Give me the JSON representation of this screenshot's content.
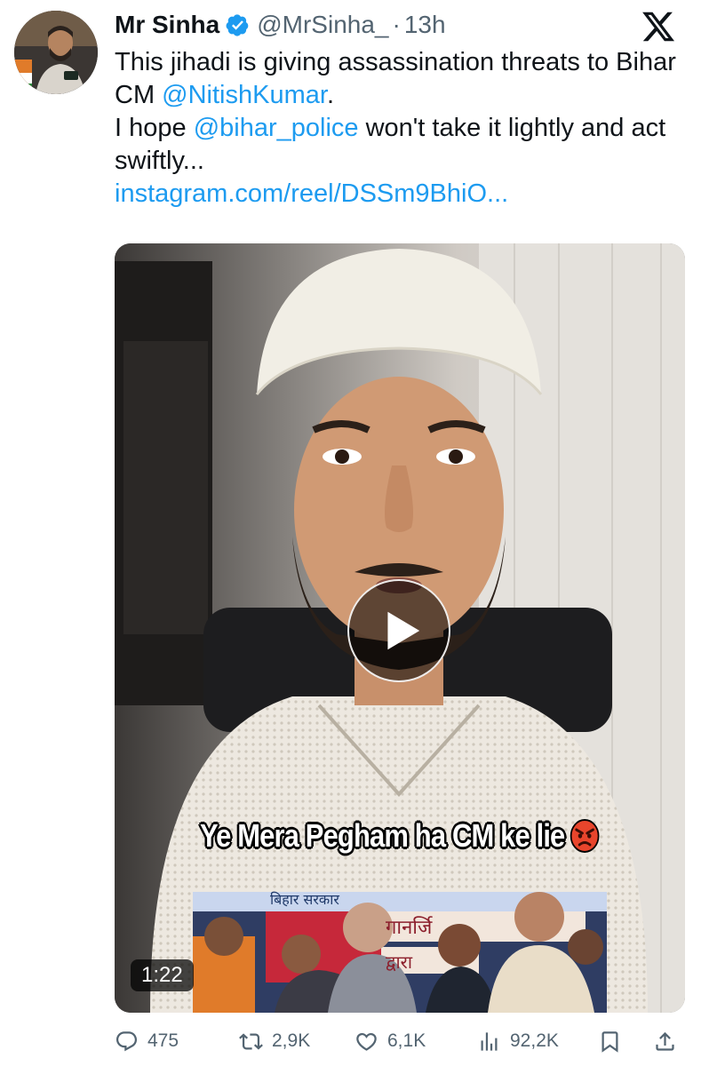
{
  "user": {
    "display_name": "Mr Sinha",
    "handle": "@MrSinha_",
    "separator": "·",
    "time": "13h"
  },
  "tweet": {
    "line1_pre": "This jihadi is giving assassination threats to Bihar CM ",
    "mention1": "@NitishKumar",
    "line1_post": ".",
    "line2_pre": "I hope ",
    "mention2": "@bihar_police",
    "line2_post": " won't take it lightly and act swiftly...",
    "link": "instagram.com/reel/DSSm9BhiO..."
  },
  "media": {
    "caption": "Ye Mera Pegham ha CM ke lie",
    "duration": "1:22",
    "inset_banner_text": "गानर्जि",
    "inset_banner_text2": "द्वारा",
    "inset_top_text": "बिहार सरकार"
  },
  "actions": {
    "replies": "475",
    "reposts": "2,9K",
    "likes": "6,1K",
    "views": "92,2K"
  },
  "colors": {
    "link": "#1d9bf0",
    "secondary_text": "#536471",
    "verified": "#1d9bf0"
  },
  "icons": [
    "verified-badge-icon",
    "x-logo-icon",
    "play-icon",
    "reply-icon",
    "repost-icon",
    "like-icon",
    "views-icon",
    "bookmark-icon",
    "share-icon",
    "angry-face-emoji"
  ]
}
